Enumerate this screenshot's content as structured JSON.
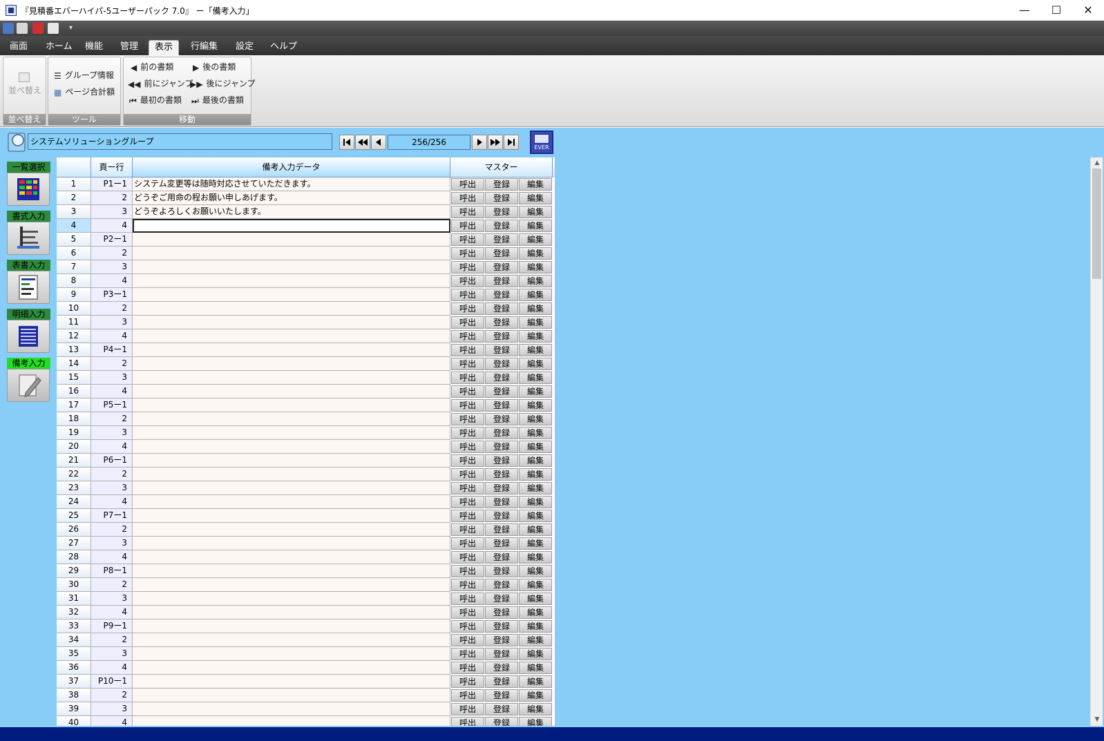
{
  "window": {
    "title": "『見積番エバーハイパ-5ユーザーパック 7.0』 ー「備考入力」",
    "minimize": "—",
    "maximize": "☐",
    "close": "✕"
  },
  "menu": {
    "tabs": [
      "画面",
      "ホーム",
      "機能",
      "管理",
      "表示",
      "行編集",
      "設定",
      "ヘルプ"
    ],
    "active": "表示"
  },
  "ribbon": {
    "sort_group": {
      "label": "並べ替え",
      "sort_button": "並べ替え"
    },
    "tool_group": {
      "label": "ツール",
      "group_info": "グループ情報",
      "page_total": "ページ合計額"
    },
    "move_group": {
      "label": "移動",
      "prev_doc": "前の書類",
      "next_doc": "後の書類",
      "jump_prev": "前にジャンプ",
      "jump_next": "後にジャンプ",
      "first_doc": "最初の書類",
      "last_doc": "最後の書類"
    }
  },
  "toolbar": {
    "group_name": "システムソリューショングループ",
    "page_indicator": "256/256",
    "ever_label": "EVER"
  },
  "sidebar": {
    "items": [
      {
        "label": "一覧選択"
      },
      {
        "label": "書式入力"
      },
      {
        "label": "表書入力"
      },
      {
        "label": "明細入力"
      },
      {
        "label": "備考入力"
      }
    ]
  },
  "grid": {
    "headers": {
      "page_line": "頁ー行",
      "remark_data": "備考入力データ",
      "master": "マスター"
    },
    "buttons": {
      "call": "呼出",
      "register": "登録",
      "edit": "編集"
    },
    "rows": [
      {
        "n": "1",
        "pg": "P1ー1",
        "txt": "システム変更等は随時対応させていただきます。"
      },
      {
        "n": "2",
        "pg": "2",
        "txt": "どうぞご用命の程お願い申しあげます。"
      },
      {
        "n": "3",
        "pg": "3",
        "txt": "どうぞよろしくお願いいたします。"
      },
      {
        "n": "4",
        "pg": "4",
        "txt": ""
      },
      {
        "n": "5",
        "pg": "P2ー1",
        "txt": ""
      },
      {
        "n": "6",
        "pg": "2",
        "txt": ""
      },
      {
        "n": "7",
        "pg": "3",
        "txt": ""
      },
      {
        "n": "8",
        "pg": "4",
        "txt": ""
      },
      {
        "n": "9",
        "pg": "P3ー1",
        "txt": ""
      },
      {
        "n": "10",
        "pg": "2",
        "txt": ""
      },
      {
        "n": "11",
        "pg": "3",
        "txt": ""
      },
      {
        "n": "12",
        "pg": "4",
        "txt": ""
      },
      {
        "n": "13",
        "pg": "P4ー1",
        "txt": ""
      },
      {
        "n": "14",
        "pg": "2",
        "txt": ""
      },
      {
        "n": "15",
        "pg": "3",
        "txt": ""
      },
      {
        "n": "16",
        "pg": "4",
        "txt": ""
      },
      {
        "n": "17",
        "pg": "P5ー1",
        "txt": ""
      },
      {
        "n": "18",
        "pg": "2",
        "txt": ""
      },
      {
        "n": "19",
        "pg": "3",
        "txt": ""
      },
      {
        "n": "20",
        "pg": "4",
        "txt": ""
      },
      {
        "n": "21",
        "pg": "P6ー1",
        "txt": ""
      },
      {
        "n": "22",
        "pg": "2",
        "txt": ""
      },
      {
        "n": "23",
        "pg": "3",
        "txt": ""
      },
      {
        "n": "24",
        "pg": "4",
        "txt": ""
      },
      {
        "n": "25",
        "pg": "P7ー1",
        "txt": ""
      },
      {
        "n": "26",
        "pg": "2",
        "txt": ""
      },
      {
        "n": "27",
        "pg": "3",
        "txt": ""
      },
      {
        "n": "28",
        "pg": "4",
        "txt": ""
      },
      {
        "n": "29",
        "pg": "P8ー1",
        "txt": ""
      },
      {
        "n": "30",
        "pg": "2",
        "txt": ""
      },
      {
        "n": "31",
        "pg": "3",
        "txt": ""
      },
      {
        "n": "32",
        "pg": "4",
        "txt": ""
      },
      {
        "n": "33",
        "pg": "P9ー1",
        "txt": ""
      },
      {
        "n": "34",
        "pg": "2",
        "txt": ""
      },
      {
        "n": "35",
        "pg": "3",
        "txt": ""
      },
      {
        "n": "36",
        "pg": "4",
        "txt": ""
      },
      {
        "n": "37",
        "pg": "P10ー1",
        "txt": ""
      },
      {
        "n": "38",
        "pg": "2",
        "txt": ""
      },
      {
        "n": "39",
        "pg": "3",
        "txt": ""
      },
      {
        "n": "40",
        "pg": "4",
        "txt": ""
      }
    ]
  },
  "colors": {
    "content_bg": "#87cdf8",
    "status_bar": "#001c7e",
    "sidebar_label": "#2e8b3c",
    "sidebar_label_active": "#22dd22",
    "ribbon_dark": "#3a3a3a"
  }
}
